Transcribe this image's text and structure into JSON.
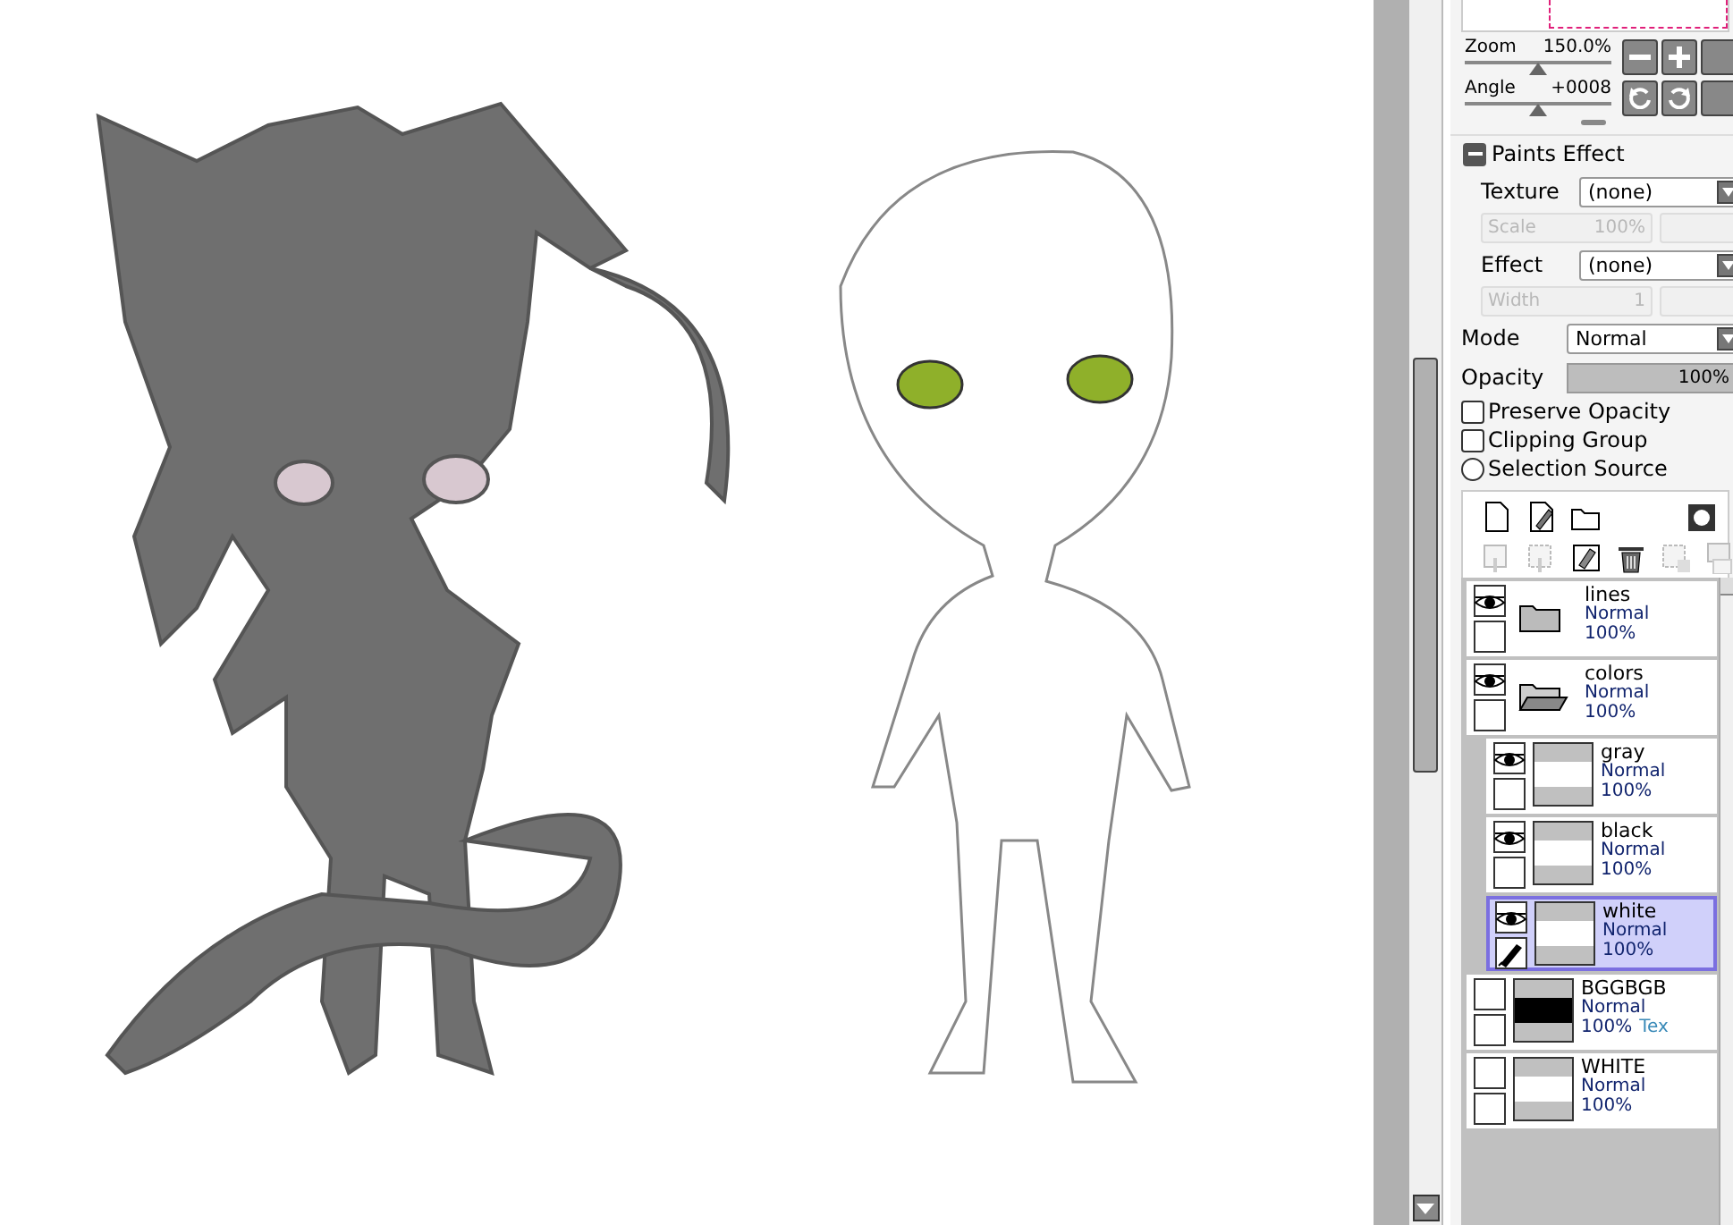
{
  "view_controls": [
    {
      "label": "Zoom",
      "value": "150.0%",
      "level": 0.5
    },
    {
      "label": "Angle",
      "value": "+0008",
      "level": 0.5
    }
  ],
  "paints_effect": {
    "title": "Paints Effect",
    "expanded": true,
    "rows": [
      {
        "kind": "select",
        "label": "Texture",
        "value": "(none)"
      },
      {
        "kind": "params",
        "label": "Scale",
        "value": "100%",
        "disabled": true
      },
      {
        "kind": "select",
        "label": "Effect",
        "value": "(none)"
      },
      {
        "kind": "params",
        "label": "Width",
        "value": "1",
        "disabled": true
      }
    ]
  },
  "mode": {
    "label": "Mode",
    "value": "Normal"
  },
  "opacity": {
    "label": "Opacity",
    "value": "100%",
    "level": 1
  },
  "options": [
    {
      "kind": "checkbox",
      "label": "Preserve Opacity",
      "checked": false
    },
    {
      "kind": "checkbox",
      "label": "Clipping Group",
      "checked": false
    },
    {
      "kind": "radio",
      "label": "Selection Source",
      "checked": false
    }
  ],
  "layers": [
    {
      "kind": "folder",
      "name": "lines",
      "mode": "Normal",
      "opacity": "100%",
      "visible": true,
      "expanded": false,
      "selected": false
    },
    {
      "kind": "folder",
      "name": "colors",
      "mode": "Normal",
      "opacity": "100%",
      "visible": true,
      "expanded": true,
      "selected": false,
      "children": [
        {
          "kind": "layer",
          "name": "gray",
          "mode": "Normal",
          "opacity": "100%",
          "visible": true,
          "selected": false,
          "color": "#ffffff"
        },
        {
          "kind": "layer",
          "name": "black",
          "mode": "Normal",
          "opacity": "100%",
          "visible": true,
          "selected": false,
          "color": "#ffffff"
        },
        {
          "kind": "layer",
          "name": "white",
          "mode": "Normal",
          "opacity": "100%",
          "visible": true,
          "selected": true,
          "color": "#ffffff"
        }
      ]
    },
    {
      "kind": "layer",
      "name": "BGGBGB",
      "mode": "Normal",
      "opacity": "100%",
      "extra": "Tex",
      "visible": false,
      "selected": false,
      "color": "#000000"
    },
    {
      "kind": "layer",
      "name": "WHITE",
      "mode": "Normal",
      "opacity": "100%",
      "visible": false,
      "selected": false,
      "color": "#ffffff"
    }
  ]
}
